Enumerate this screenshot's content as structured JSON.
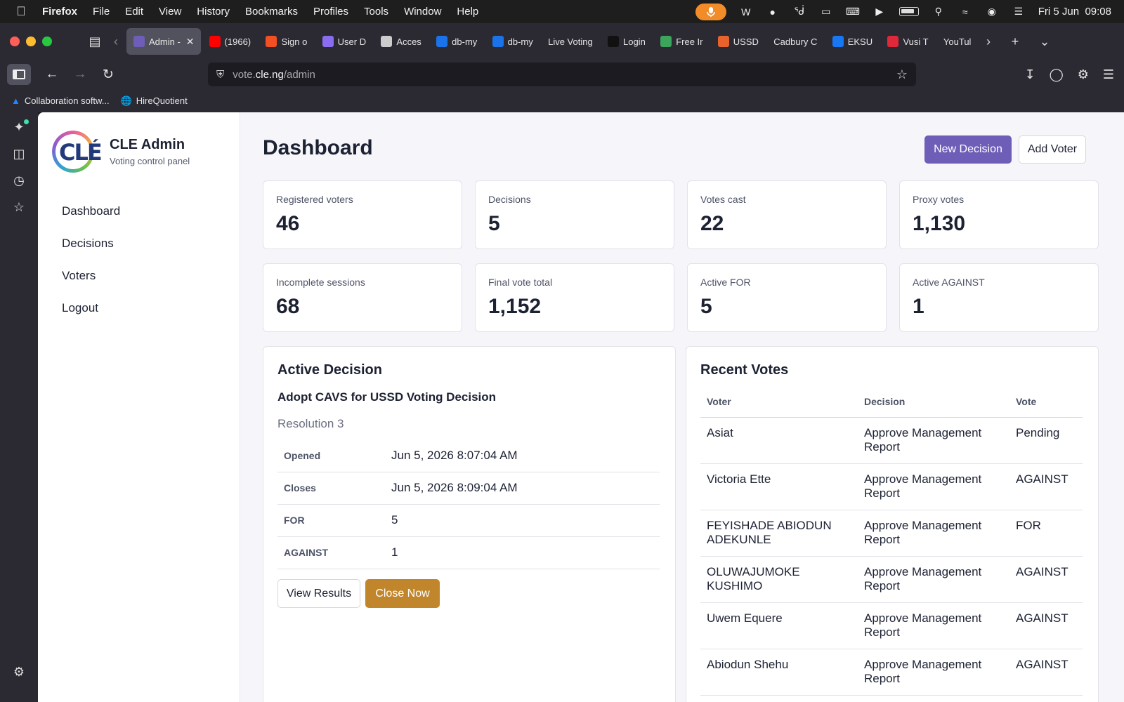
{
  "menubar": {
    "app": "Firefox",
    "items": [
      "File",
      "Edit",
      "View",
      "History",
      "Bookmarks",
      "Profiles",
      "Tools",
      "Window",
      "Help"
    ],
    "clock": "Fri 5 Jun  09:08"
  },
  "tabs": [
    {
      "label": "Admin -",
      "color": "#6e5eb8",
      "active": true
    },
    {
      "label": "(1966)",
      "color": "#ff0000"
    },
    {
      "label": "Sign o",
      "color": "#f25022"
    },
    {
      "label": "User D",
      "color": "#8a6cf0"
    },
    {
      "label": "Acces",
      "color": "#cccccc"
    },
    {
      "label": "db-my",
      "color": "#1a73e8"
    },
    {
      "label": "db-my",
      "color": "#1a73e8"
    },
    {
      "label": "Live Voting",
      "color": ""
    },
    {
      "label": "Login",
      "color": "#111111"
    },
    {
      "label": "Free Ir",
      "color": "#3ba55c"
    },
    {
      "label": "USSD",
      "color": "#e8632b"
    },
    {
      "label": "Cadbury C",
      "color": ""
    },
    {
      "label": "EKSU",
      "color": "#1877f2"
    },
    {
      "label": "Vusi T",
      "color": "#e0283a"
    },
    {
      "label": "YouTul",
      "color": ""
    }
  ],
  "url": {
    "scheme": "vote.",
    "domain": "cle.ng",
    "path": "/admin"
  },
  "bookmarks": [
    {
      "label": "Collaboration softw...",
      "icon": "atlassian-icon"
    },
    {
      "label": "HireQuotient",
      "icon": "globe-icon"
    }
  ],
  "app": {
    "brand_title": "CLE Admin",
    "brand_sub": "Voting control panel",
    "logo_text": "CLÉ",
    "nav": [
      "Dashboard",
      "Decisions",
      "Voters",
      "Logout"
    ]
  },
  "header": {
    "title": "Dashboard",
    "new_decision": "New Decision",
    "add_voter": "Add Voter"
  },
  "stats": [
    {
      "label": "Registered voters",
      "value": "46"
    },
    {
      "label": "Decisions",
      "value": "5"
    },
    {
      "label": "Votes cast",
      "value": "22"
    },
    {
      "label": "Proxy votes",
      "value": "1,130"
    },
    {
      "label": "Incomplete sessions",
      "value": "68"
    },
    {
      "label": "Final vote total",
      "value": "1,152"
    },
    {
      "label": "Active FOR",
      "value": "5"
    },
    {
      "label": "Active AGAINST",
      "value": "1"
    }
  ],
  "active_decision": {
    "heading": "Active Decision",
    "title": "Adopt CAVS for USSD Voting Decision",
    "subtitle": "Resolution 3",
    "rows": [
      {
        "key": "Opened",
        "value": "Jun 5, 2026 8:07:04 AM"
      },
      {
        "key": "Closes",
        "value": "Jun 5, 2026 8:09:04 AM"
      },
      {
        "key": "FOR",
        "value": "5"
      },
      {
        "key": "AGAINST",
        "value": "1"
      }
    ],
    "view_results": "View Results",
    "close_now": "Close Now"
  },
  "recent_votes": {
    "heading": "Recent Votes",
    "columns": [
      "Voter",
      "Decision",
      "Vote"
    ],
    "rows": [
      {
        "voter": "Asiat",
        "decision": "Approve Management Report",
        "vote": "Pending"
      },
      {
        "voter": "Victoria Ette",
        "decision": "Approve Management Report",
        "vote": "AGAINST"
      },
      {
        "voter": "FEYISHADE ABIODUN ADEKUNLE",
        "decision": "Approve Management Report",
        "vote": "FOR"
      },
      {
        "voter": "OLUWAJUMOKE KUSHIMO",
        "decision": "Approve Management Report",
        "vote": "AGAINST"
      },
      {
        "voter": "Uwem Equere",
        "decision": "Approve Management Report",
        "vote": "AGAINST"
      },
      {
        "voter": "Abiodun Shehu",
        "decision": "Approve Management Report",
        "vote": "AGAINST"
      }
    ]
  },
  "colors": {
    "primary": "#6e5eb8",
    "gold": "#c1862c"
  }
}
